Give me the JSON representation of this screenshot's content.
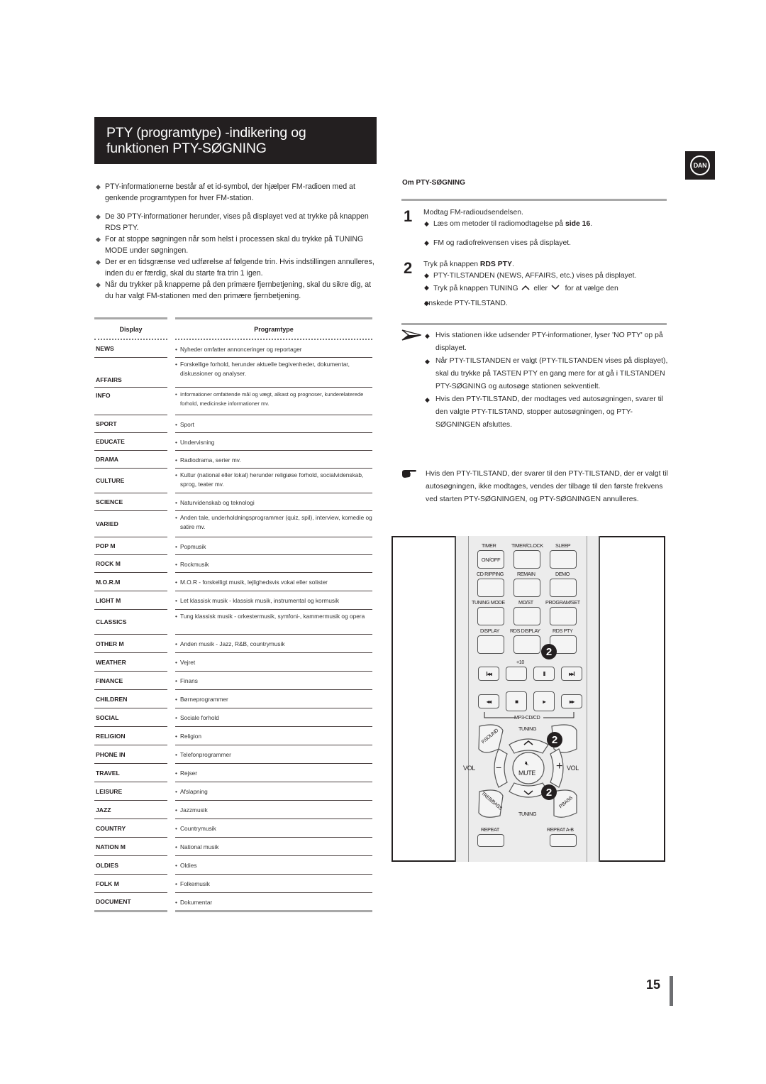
{
  "title": {
    "line1": "PTY (programtype) -indikering og",
    "line2": "funktionen PTY-SØGNING"
  },
  "language_badge": "DAN",
  "intro_bullets": [
    "PTY-informationerne består af et id-symbol, der hjælper FM-radioen med at genkende programtypen for hver FM-station.",
    "De 30 PTY-informationer herunder, vises på displayet ved at trykke på knappen RDS PTY.",
    "For at stoppe søgningen når som helst i processen skal du trykke på TUNING MODE under søgningen.",
    "Der er en tidsgrænse ved udførelse af følgende trin. Hvis indstillingen annulleres, inden du er færdig, skal du starte fra trin 1 igen.",
    "Når du trykker på knapperne på den primære fjernbetjening, skal du sikre dig, at du har valgt FM-stationen med den primære fjernbetjening."
  ],
  "pty_table": {
    "headers": [
      "Display",
      "Programtype"
    ],
    "rows": [
      {
        "display": "NEWS",
        "type": "Nyheder omfatter annonceringer og reportager"
      },
      {
        "display": "AFFAIRS",
        "type": "Forskellige forhold, herunder aktuelle begivenheder, dokumentar, diskussioner og analyser."
      },
      {
        "display": "INFO",
        "type": "Informationer omfattende mål og vægt, alkast og prognoser, kunderelaterede forhold, medicinske informationer mv."
      },
      {
        "display": "SPORT",
        "type": "Sport"
      },
      {
        "display": "EDUCATE",
        "type": "Undervisning"
      },
      {
        "display": "DRAMA",
        "type": "Radiodrama, serier mv."
      },
      {
        "display": "CULTURE",
        "type": "Kultur (national eller lokal) herunder religiøse forhold, socialvidenskab, sprog, teater mv."
      },
      {
        "display": "SCIENCE",
        "type": "Naturvidenskab og teknologi"
      },
      {
        "display": "VARIED",
        "type": "Anden tale, underholdningsprogrammer (quiz, spil), interview, komedie og satire mv."
      },
      {
        "display": "POP M",
        "type": "Popmusik"
      },
      {
        "display": "ROCK M",
        "type": "Rockmusik"
      },
      {
        "display": "M.O.R.M",
        "type": "M.O.R - forskelligt musik, lejlighedsvis vokal eller solister"
      },
      {
        "display": "LIGHT M",
        "type": "Let klassisk musik - klassisk musik, instrumental og kormusik"
      },
      {
        "display": "CLASSICS",
        "type": "Tung klassisk musik - orkestermusik, symfoni-, kammermusik og opera"
      },
      {
        "display": "OTHER M",
        "type": "Anden musik - Jazz, R&B, countrymusik"
      },
      {
        "display": "WEATHER",
        "type": "Vejret"
      },
      {
        "display": "FINANCE",
        "type": "Finans"
      },
      {
        "display": "CHILDREN",
        "type": "Børneprogrammer"
      },
      {
        "display": "SOCIAL",
        "type": "Sociale forhold"
      },
      {
        "display": "RELIGION",
        "type": "Religion"
      },
      {
        "display": "PHONE IN",
        "type": "Telefonprogrammer"
      },
      {
        "display": "TRAVEL",
        "type": "Rejser"
      },
      {
        "display": "LEISURE",
        "type": "Afslapning"
      },
      {
        "display": "JAZZ",
        "type": "Jazzmusik"
      },
      {
        "display": "COUNTRY",
        "type": "Countrymusik"
      },
      {
        "display": "NATION M",
        "type": "National musik"
      },
      {
        "display": "OLDIES",
        "type": "Oldies"
      },
      {
        "display": "FOLK M",
        "type": "Folkemusik"
      },
      {
        "display": "DOCUMENT",
        "type": "Dokumentar"
      }
    ]
  },
  "search_section": {
    "heading": "Om PTY-SØGNING",
    "step1": {
      "number": "1",
      "text": "Modtag FM-radioudsendelsen.",
      "sub1_prefix": "Læs om metoder til radiomodtagelse på ",
      "sub1_bold": "side 16",
      "sub1_suffix": ".",
      "sub2": "FM og radiofrekvensen vises på displayet."
    },
    "step2": {
      "number": "2",
      "text_prefix": "Tryk på knappen ",
      "text_bold": "RDS PTY",
      "text_suffix": ".",
      "sub1": "PTY-TILSTANDEN (NEWS, AFFAIRS, etc.) vises på displayet.",
      "sub2_prefix": "Tryk på knappen TUNING",
      "sub2_up": "^",
      "sub2_mid": "eller",
      "sub2_down": "v",
      "sub2_suffix": "for at vælge den",
      "sub2_line2": "ønskede PTY-TILSTAND."
    },
    "notes": [
      "Hvis stationen ikke udsender PTY-informationer, lyser 'NO PTY' op på displayet.",
      "Når PTY-TILSTANDEN er valgt (PTY-TILSTANDEN vises på displayet), skal du trykke på TASTEN PTY en gang mere for at gå i TILSTANDEN PTY-SØGNING og autosøge stationen sekventielt.",
      "Hvis den PTY-TILSTAND, der modtages ved autosøgningen, svarer til den valgte PTY-TILSTAND, stopper autosøgningen, og PTY-SØGNINGEN afsluttes."
    ],
    "hand_note": "Hvis den PTY-TILSTAND, der svarer til den PTY-TILSTAND, der er valgt til autosøgningen, ikke modtages, vendes der tilbage til den første frekvens ved starten PTY-SØGNINGEN, og PTY-SØGNINGEN annulleres."
  },
  "remote": {
    "labels": {
      "timer": "TIMER",
      "timer_clock": "TIMER/CLOCK",
      "sleep": "SLEEP",
      "on_off": "ON/OFF",
      "cd_ripping": "CD RIPPING",
      "remain": "REMAIN",
      "demo": "DEMO",
      "tuning_mode": "TUNING MODE",
      "mo_st": "MO/ST",
      "program_set": "PROGRAM/SET",
      "display": "DISPLAY",
      "rds_display": "RDS DISPLAY",
      "rds_pty": "RDS PTY",
      "plus10": "+10",
      "prev": "I◂◂",
      "pause": "II",
      "next": "▸▸I",
      "rew": "◂◂",
      "stop": "■",
      "play": "▸",
      "ff": "▸▸",
      "mp3_cd": "MP3-CD/CD",
      "p_sound": "P.SOUND",
      "tuning_up_label": "TUNING",
      "tuning_down_label": "TUNING",
      "vol_left": "VOL",
      "vol_right": "VOL",
      "minus": "−",
      "plus": "+",
      "mute": "MUTE",
      "treb_bass": "TREB/BASS",
      "p_bass": "P.BASS",
      "repeat": "REPEAT",
      "repeat_ab": "REPEAT A-B"
    },
    "callouts": [
      "2",
      "2",
      "2"
    ]
  },
  "page_number": "15"
}
